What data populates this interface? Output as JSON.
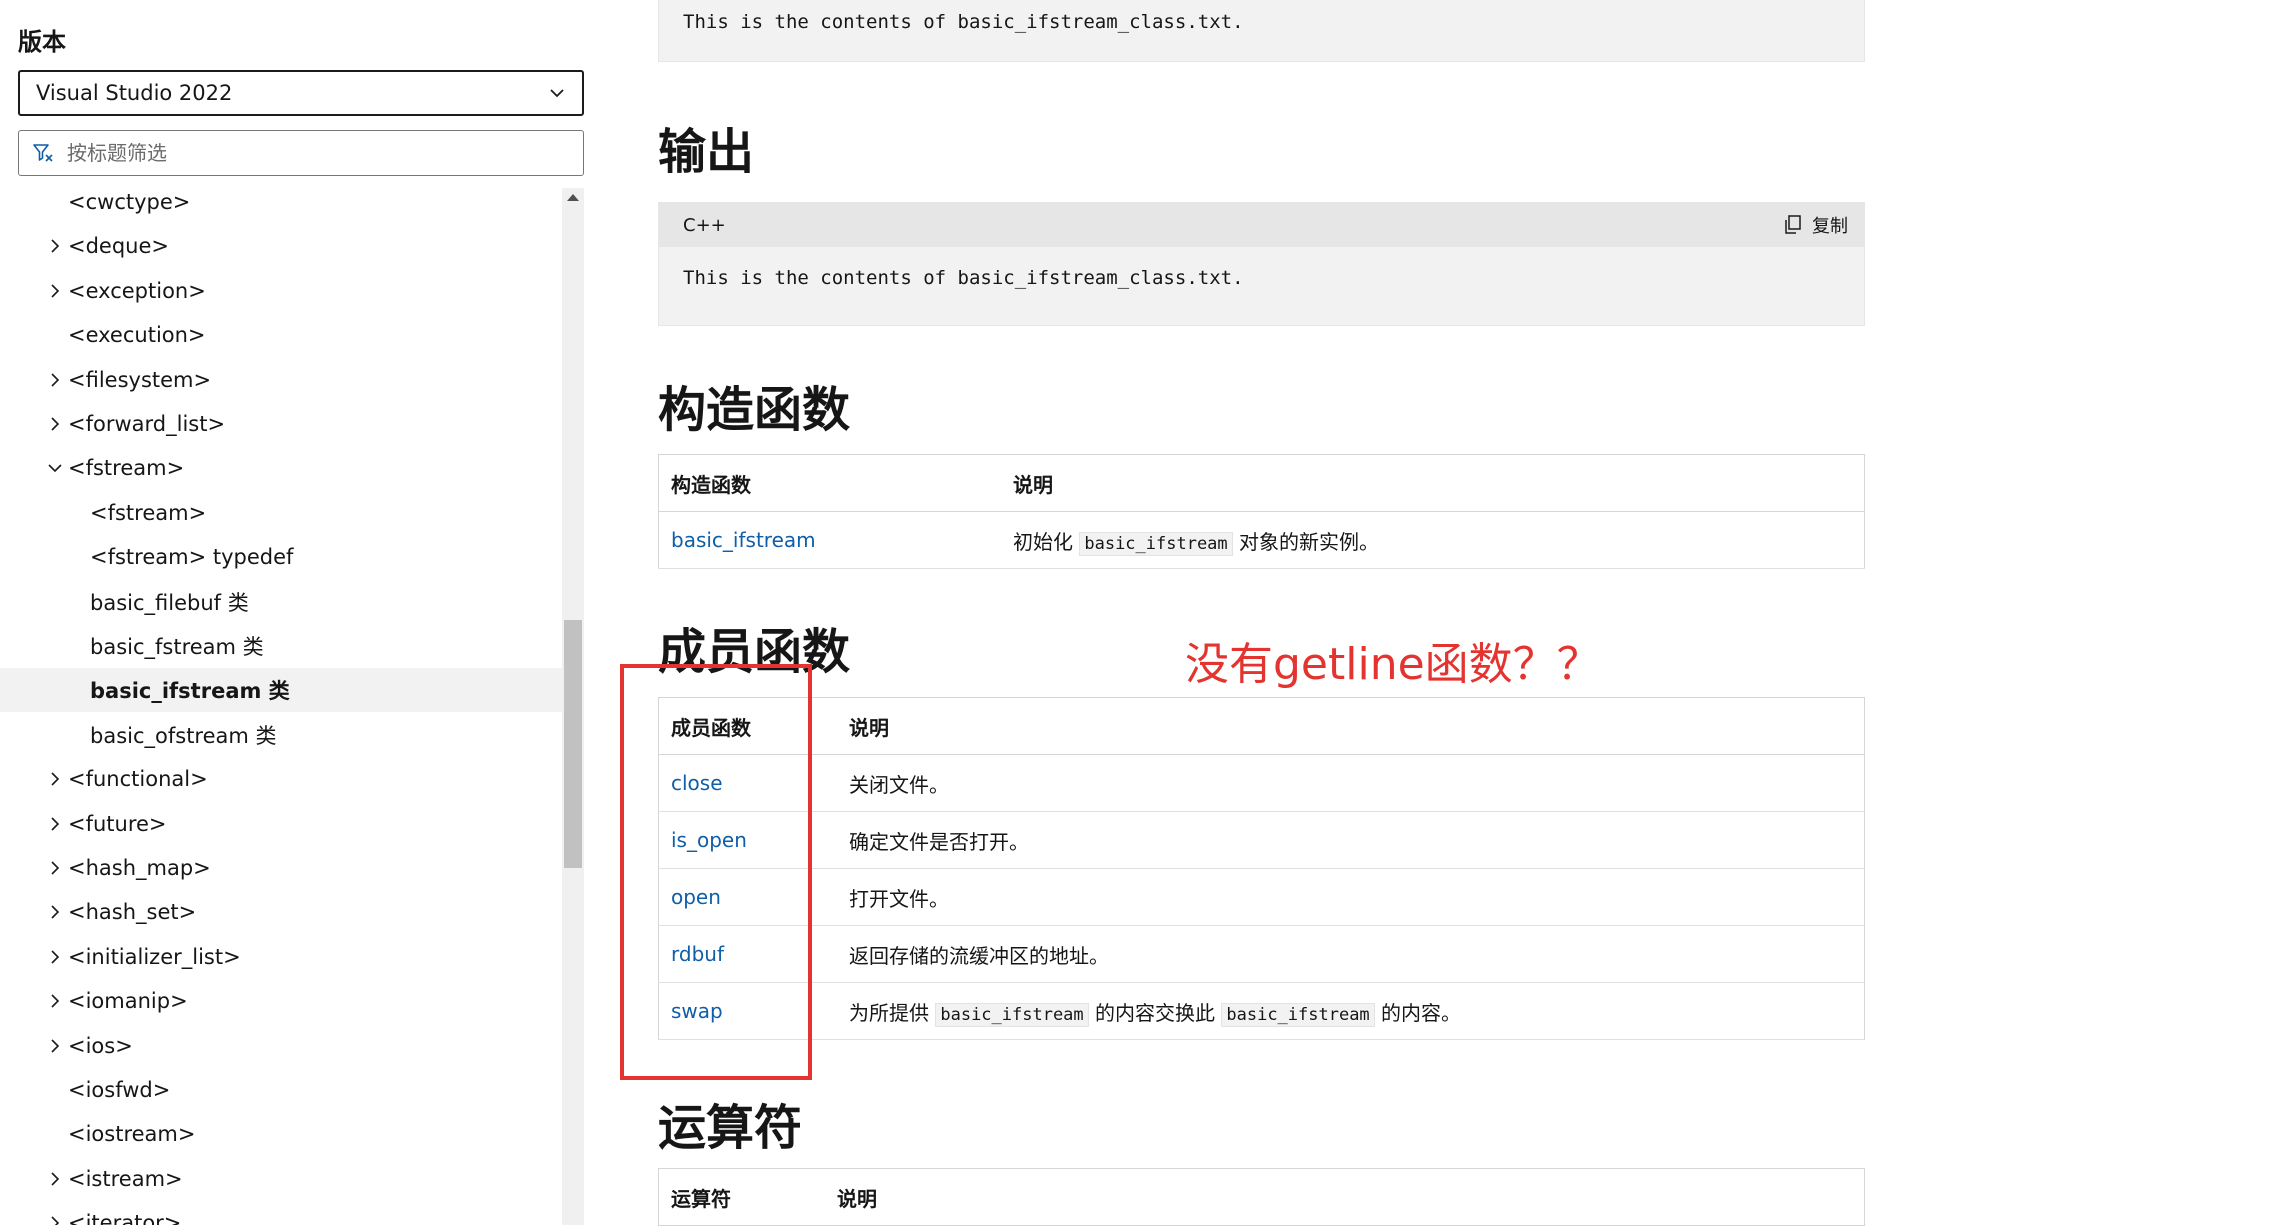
{
  "sidebar": {
    "version_label": "版本",
    "version_selected": "Visual Studio 2022",
    "filter_placeholder": "按标题筛选",
    "items": [
      {
        "label": "<cwctype>",
        "has_arrow": false,
        "expanded": false,
        "indent": 1
      },
      {
        "label": "<deque>",
        "has_arrow": true,
        "expanded": false,
        "indent": 1
      },
      {
        "label": "<exception>",
        "has_arrow": true,
        "expanded": false,
        "indent": 1
      },
      {
        "label": "<execution>",
        "has_arrow": false,
        "expanded": false,
        "indent": 1
      },
      {
        "label": "<filesystem>",
        "has_arrow": true,
        "expanded": false,
        "indent": 1
      },
      {
        "label": "<forward_list>",
        "has_arrow": true,
        "expanded": false,
        "indent": 1
      },
      {
        "label": "<fstream>",
        "has_arrow": true,
        "expanded": true,
        "indent": 1
      },
      {
        "label": "<fstream>",
        "has_arrow": false,
        "expanded": false,
        "indent": 2
      },
      {
        "label": "<fstream> typedef",
        "has_arrow": false,
        "expanded": false,
        "indent": 2
      },
      {
        "label": "basic_filebuf 类",
        "has_arrow": false,
        "expanded": false,
        "indent": 2
      },
      {
        "label": "basic_fstream 类",
        "has_arrow": false,
        "expanded": false,
        "indent": 2
      },
      {
        "label": "basic_ifstream 类",
        "has_arrow": false,
        "expanded": false,
        "indent": 2,
        "selected": true
      },
      {
        "label": "basic_ofstream 类",
        "has_arrow": false,
        "expanded": false,
        "indent": 2
      },
      {
        "label": "<functional>",
        "has_arrow": true,
        "expanded": false,
        "indent": 1
      },
      {
        "label": "<future>",
        "has_arrow": true,
        "expanded": false,
        "indent": 1
      },
      {
        "label": "<hash_map>",
        "has_arrow": true,
        "expanded": false,
        "indent": 1
      },
      {
        "label": "<hash_set>",
        "has_arrow": true,
        "expanded": false,
        "indent": 1
      },
      {
        "label": "<initializer_list>",
        "has_arrow": true,
        "expanded": false,
        "indent": 1
      },
      {
        "label": "<iomanip>",
        "has_arrow": true,
        "expanded": false,
        "indent": 1
      },
      {
        "label": "<ios>",
        "has_arrow": true,
        "expanded": false,
        "indent": 1
      },
      {
        "label": "<iosfwd>",
        "has_arrow": false,
        "expanded": false,
        "indent": 1
      },
      {
        "label": "<iostream>",
        "has_arrow": false,
        "expanded": false,
        "indent": 1
      },
      {
        "label": "<istream>",
        "has_arrow": true,
        "expanded": false,
        "indent": 1
      },
      {
        "label": "<iterator>",
        "has_arrow": true,
        "expanded": false,
        "indent": 1
      }
    ]
  },
  "main": {
    "top_code": "This is the contents of basic_ifstream_class.txt.",
    "output_heading": "输出",
    "output_code": {
      "language": "C++",
      "copy_label": "复制",
      "text": "This is the contents of basic_ifstream_class.txt."
    },
    "constructors": {
      "heading": "构造函数",
      "col1": "构造函数",
      "col2": "说明",
      "rows": [
        {
          "name": "basic_ifstream",
          "desc_pre": "初始化 ",
          "desc_code": "basic_ifstream",
          "desc_post": " 对象的新实例。"
        }
      ]
    },
    "members": {
      "heading": "成员函数",
      "col1": "成员函数",
      "col2": "说明",
      "rows": [
        {
          "name": "close",
          "desc": "关闭文件。"
        },
        {
          "name": "is_open",
          "desc": "确定文件是否打开。"
        },
        {
          "name": "open",
          "desc": "打开文件。"
        },
        {
          "name": "rdbuf",
          "desc": "返回存储的流缓冲区的地址。"
        }
      ],
      "swap_row": {
        "name": "swap",
        "desc_a": "为所提供 ",
        "code_a": "basic_ifstream",
        "desc_b": " 的内容交换此 ",
        "code_b": "basic_ifstream",
        "desc_c": " 的内容。"
      }
    },
    "operators": {
      "heading": "运算符",
      "col1": "运算符",
      "col2": "说明"
    },
    "annotation": "没有getline函数？？"
  },
  "colors": {
    "link": "#0f5ea8",
    "annotation_red": "#e3342f",
    "code_bg": "#f2f2f2"
  }
}
